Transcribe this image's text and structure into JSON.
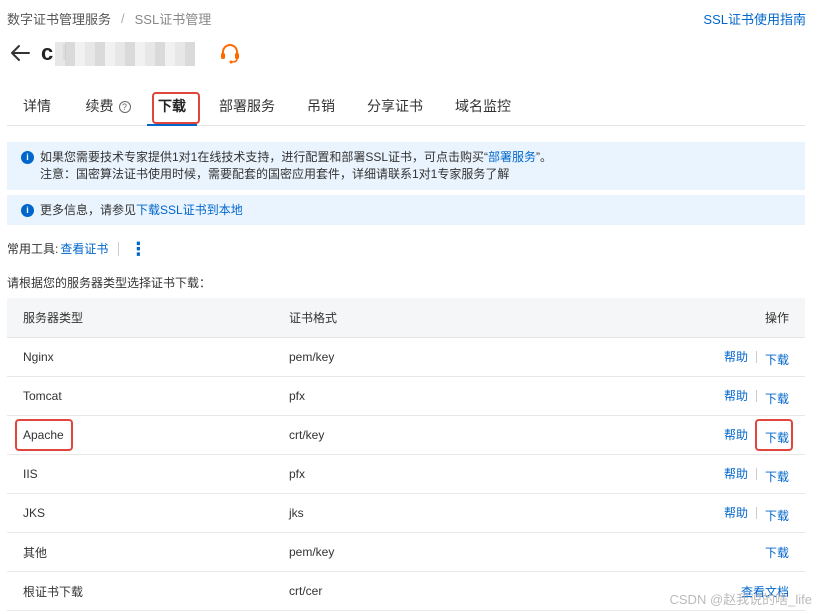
{
  "breadcrumb": {
    "item1": "数字证书管理服务",
    "separator": "/",
    "item2": "SSL证书管理"
  },
  "header": {
    "guide_link": "SSL证书使用指南",
    "title": "c   l"
  },
  "tabs": [
    {
      "label": "详情"
    },
    {
      "label": "续费"
    },
    {
      "label": "下载"
    },
    {
      "label": "部署服务"
    },
    {
      "label": "吊销"
    },
    {
      "label": "分享证书"
    },
    {
      "label": "域名监控"
    }
  ],
  "notice1": {
    "line1_prefix": "如果您需要技术专家提供1对1在线技术支持，进行配置和部署SSL证书，可点击购买“",
    "line1_link": "部署服务",
    "line1_suffix": "”。",
    "line2": "注意：国密算法证书使用时候，需要配套的国密应用套件，详细请联系1对1专家服务了解"
  },
  "notice2": {
    "prefix": "更多信息，请参见",
    "link": "下载SSL证书到本地"
  },
  "tools": {
    "label": "常用工具:",
    "link": "查看证书",
    "more": "⋮"
  },
  "instruction": "请根据您的服务器类型选择证书下载：",
  "table": {
    "headers": [
      "服务器类型",
      "证书格式",
      "操作"
    ],
    "rows": [
      {
        "server": "Nginx",
        "format": "pem/key",
        "help": "帮助",
        "download": "下载"
      },
      {
        "server": "Tomcat",
        "format": "pfx",
        "help": "帮助",
        "download": "下载"
      },
      {
        "server": "Apache",
        "format": "crt/key",
        "help": "帮助",
        "download": "下载"
      },
      {
        "server": "IIS",
        "format": "pfx",
        "help": "帮助",
        "download": "下载"
      },
      {
        "server": "JKS",
        "format": "jks",
        "help": "帮助",
        "download": "下载"
      },
      {
        "server": "其他",
        "format": "pem/key",
        "help": "",
        "download": "下载"
      },
      {
        "server": "根证书下载",
        "format": "crt/cer",
        "help": "",
        "download": "查看文档"
      }
    ]
  },
  "watermark": "CSDN @赵我说的啥_life",
  "colors": {
    "accent": "#0066cc",
    "highlight": "#e0463e",
    "notice_bg": "#eaf4fe",
    "support_icon": "#ff6a00"
  }
}
